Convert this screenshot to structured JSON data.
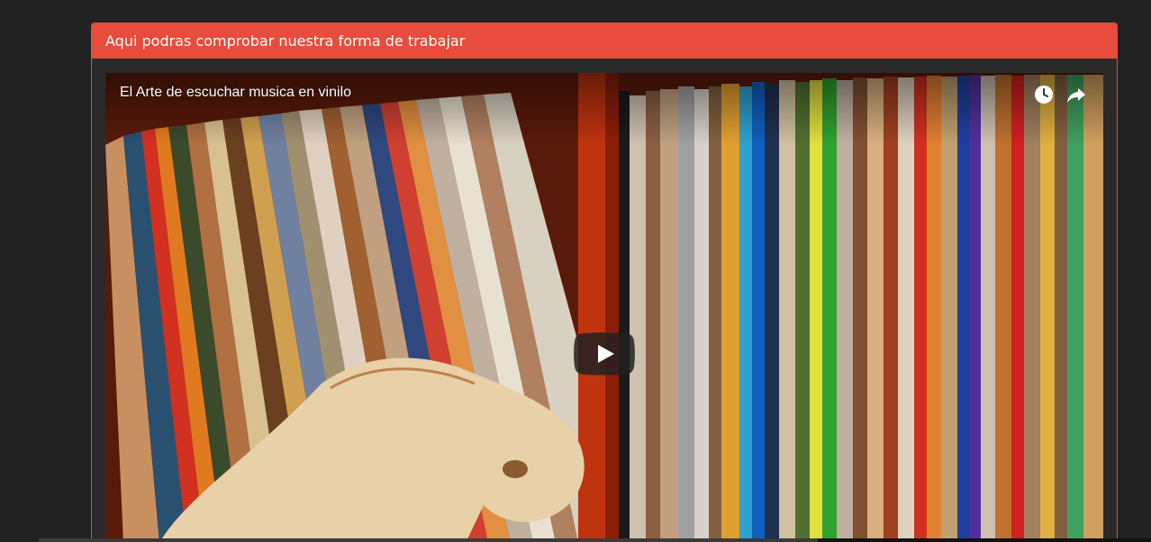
{
  "panel": {
    "heading": "Aqui podras comprobar nuestra forma de trabajar",
    "accent_color": "#e74c3c"
  },
  "video": {
    "title": "El Arte de escuchar musica en vinilo",
    "icons": {
      "watch_later": "clock-icon",
      "share": "share-icon",
      "play": "play-icon"
    },
    "thumbnail_subject": "vinyl-record-shelf"
  }
}
